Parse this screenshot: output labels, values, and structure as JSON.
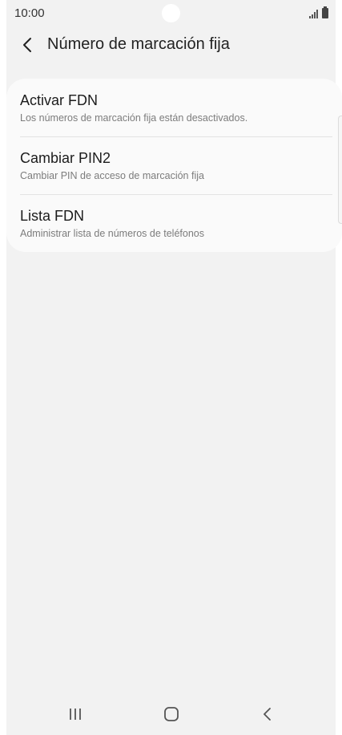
{
  "status_bar": {
    "time": "10:00"
  },
  "header": {
    "back_icon": "chevron-left-icon",
    "title": "Número de marcación fija"
  },
  "settings": {
    "items": [
      {
        "title": "Activar FDN",
        "subtitle": "Los números de marcación fija están desactivados."
      },
      {
        "title": "Cambiar PIN2",
        "subtitle": "Cambiar PIN de acceso de marcación fija"
      },
      {
        "title": "Lista FDN",
        "subtitle": "Administrar lista de números de teléfonos"
      }
    ]
  },
  "nav_bar": {
    "recents_icon": "recent-apps-icon",
    "home_icon": "home-icon",
    "back_icon": "back-icon"
  },
  "colors": {
    "background": "#f2f2f2",
    "card": "#fafafa",
    "title_text": "#1c1c1c",
    "subtitle_text": "#7c7c7c"
  }
}
